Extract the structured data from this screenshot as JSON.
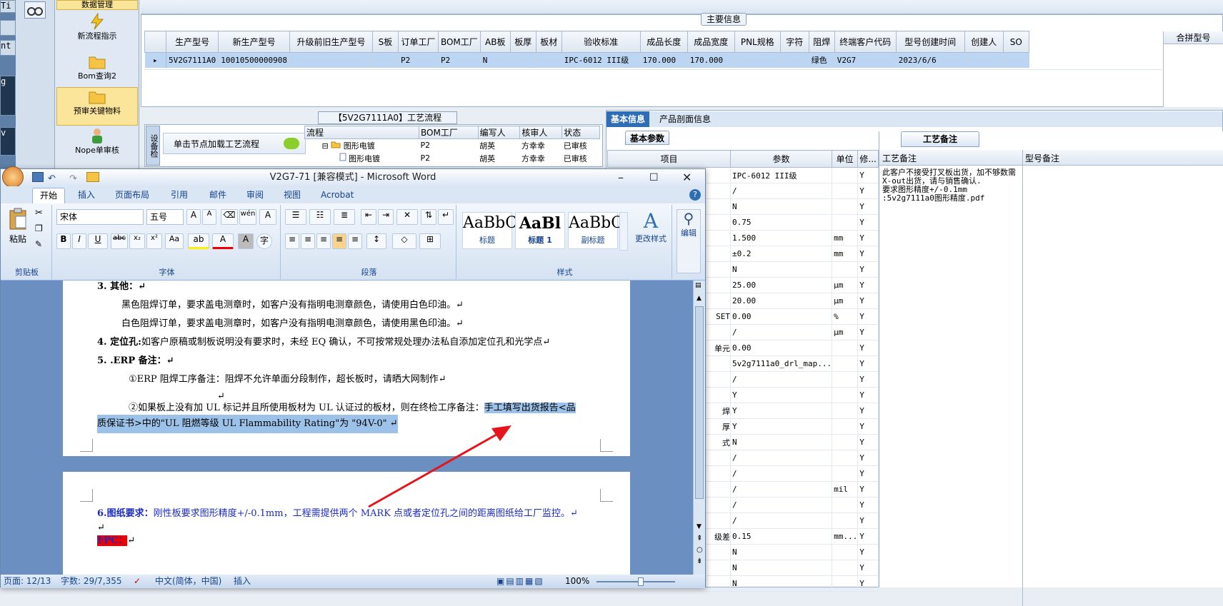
{
  "left_strip": {
    "items": [
      "Ti",
      "",
      "nt",
      "g",
      "v"
    ]
  },
  "nav": {
    "items": [
      {
        "label": "数据管理"
      },
      {
        "label": "新流程指示"
      },
      {
        "label": "Bom查询2"
      },
      {
        "label": "预审关键物料"
      },
      {
        "label": "Nope单审核"
      }
    ]
  },
  "main_info": {
    "title": "主要信息",
    "columns": [
      "生产型号",
      "新生产型号",
      "升级前旧生产型号",
      "S板",
      "订单工厂",
      "BOM工厂",
      "AB板",
      "板厚",
      "板材",
      "验收标准",
      "成品长度",
      "成品宽度",
      "PNL规格",
      "字符",
      "阻焊",
      "终端客户代码",
      "型号创建时间",
      "创建人",
      "SO"
    ],
    "right_column": "合拼型号",
    "row": [
      "5V2G7111A0",
      "10010500000908",
      "",
      "",
      "P2",
      "P2",
      "N",
      "",
      "",
      "IPC-6012 III级",
      "170.000",
      "170.000",
      "",
      "",
      "绿色",
      "V2G7",
      "2023/6/6",
      "",
      ""
    ]
  },
  "flow": {
    "title": "【5V2G7111A0】工艺流程",
    "side_label": "设备检",
    "hint": "单击节点加载工艺流程",
    "columns": [
      "流程",
      "BOM工厂",
      "编写人",
      "核审人",
      "状态"
    ],
    "rows": [
      [
        "图形电镀",
        "P2",
        "胡英",
        "方幸幸",
        "已审核"
      ],
      [
        "图形电镀",
        "P2",
        "胡英",
        "方幸幸",
        "已审核"
      ]
    ]
  },
  "right": {
    "tabs": [
      "基本信息",
      "产品剖面信息"
    ],
    "subtab": "基本参数",
    "grid_columns": [
      "项目",
      "参数",
      "单位",
      "修..."
    ],
    "grid_rows": [
      [
        "",
        "IPC-6012 III级",
        "",
        "Y"
      ],
      [
        "",
        "/",
        "",
        "Y"
      ],
      [
        "",
        "N",
        "",
        "Y"
      ],
      [
        "",
        "0.75",
        "",
        "Y"
      ],
      [
        "",
        "1.500",
        "mm",
        "Y"
      ],
      [
        "",
        "±0.2",
        "mm",
        "Y"
      ],
      [
        "",
        "N",
        "",
        "Y"
      ],
      [
        "",
        "25.00",
        "μm",
        "Y"
      ],
      [
        "",
        "20.00",
        "μm",
        "Y"
      ],
      [
        "SET",
        "0.00",
        "%",
        "Y"
      ],
      [
        "",
        "/",
        "μm",
        "Y"
      ],
      [
        "单元",
        "0.00",
        "",
        "Y"
      ],
      [
        "",
        "5v2g7111a0_drl_map...",
        "",
        "Y"
      ],
      [
        "",
        "/",
        "",
        "Y"
      ],
      [
        "",
        "Y",
        "",
        "Y"
      ],
      [
        "焊",
        "Y",
        "",
        "Y"
      ],
      [
        "厚",
        "Y",
        "",
        "Y"
      ],
      [
        "式",
        "N",
        "",
        "Y"
      ],
      [
        "",
        "/",
        "",
        "Y"
      ],
      [
        "",
        "/",
        "",
        "Y"
      ],
      [
        "",
        "/",
        "mil",
        "Y"
      ],
      [
        "",
        "/",
        "",
        "Y"
      ],
      [
        "",
        "/",
        "",
        "Y"
      ],
      [
        "级差",
        "0.15",
        "mm...",
        "Y"
      ],
      [
        "",
        "N",
        "",
        "Y"
      ],
      [
        "",
        "N",
        "",
        "Y"
      ],
      [
        "",
        "N",
        "",
        "Y"
      ]
    ],
    "process_note_tab": "工艺备注",
    "process_note_header": "工艺备注",
    "model_note_header": "型号备注",
    "process_note_text": "此客户不接受打叉板出货，加不够数需X-out出货，请与销售确认.\n要求图形精度+/-0.1mm\n:5v2g7111a0图形精度.pdf"
  },
  "word": {
    "title": "V2G7-71 [兼容模式] - Microsoft Word",
    "tabs": [
      "开始",
      "插入",
      "页面布局",
      "引用",
      "邮件",
      "审阅",
      "视图",
      "Acrobat"
    ],
    "font": "宋体",
    "size": "五号",
    "groups": [
      "剪贴板",
      "字体",
      "段落",
      "样式"
    ],
    "paste": "粘贴",
    "styles": [
      {
        "sample": "AaBbC",
        "name": "标题"
      },
      {
        "sample": "AaBl",
        "name": "标题 1"
      },
      {
        "sample": "AaBbC",
        "name": "副标题"
      }
    ],
    "change_style": "更改样式",
    "edit": "编辑",
    "doc": {
      "l1": "3.  其他：↵",
      "l2": "黑色阻焊订单，要求盖电测章时，如客户没有指明电测章颜色，请使用白色印油。↵",
      "l3": "白色阻焊订单，要求盖电测章时，如客户没有指明电测章颜色，请使用黑色印油。↵",
      "l4a": "4.  定位孔:",
      "l4b": "如客户原稿或制板说明没有要求时，未经 EQ 确认，不可按常规处理办法私自添加定位孔和光学点↵",
      "l5": "5. .ERP 备注：↵",
      "l6": "①ERP 阻焊工序备注：阻焊不允许单面分段制作，超长板时，请晒大网制作↵",
      "l7": "↵",
      "l8a": "②如果板上没有加 UL 标记并且所使用板材为 UL 认证过的板材，则在终检工序备注：",
      "l8b": "手工填写出货报告<品",
      "l9": "质保证书>中的\"UL 阻燃等级 UL Flammability Rating\"为 \"94V-0\"           ↵",
      "p2a": "6.图纸要求：",
      "p2b": "刚性板要求图形精度+/-0.1mm，工程需提供两个 MARK 点或者定位孔之间的距离图纸给工厂监控。↵",
      "p2c": "↵",
      "p2d": "FPC：",
      "p2e": "↵"
    },
    "status": {
      "page": "页面: 12/13",
      "words": "字数: 29/7,355",
      "lang": "中文(简体，中国)",
      "mode": "插入",
      "zoom": "100%"
    }
  },
  "colors": {
    "arrow": "#e8141c",
    "tab_active": "#2f6eb5",
    "highlight": "#9cc2ea",
    "nav_selected": "#fbe59a"
  }
}
